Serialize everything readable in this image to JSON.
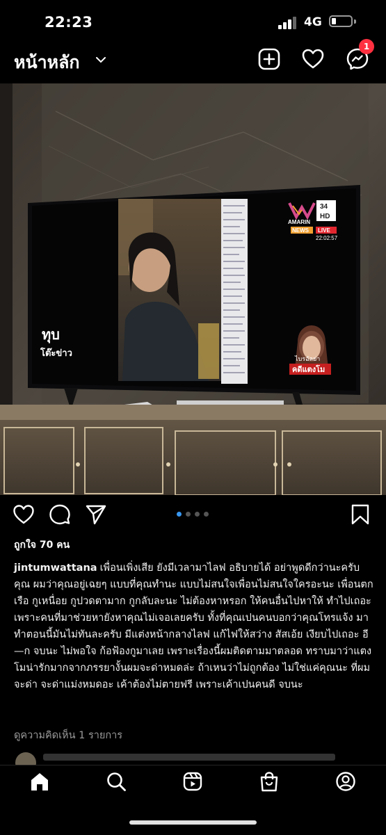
{
  "status": {
    "time": "22:23",
    "network": "4G"
  },
  "header": {
    "title": "หน้าหลัก",
    "notification_count": "1"
  },
  "post": {
    "likes": "ถูกใจ 70 คน",
    "username": "jintumwattana",
    "caption": "เพื่อนเพิ่งเสีย ยังมีเวลามาไลฟ อธิบายได้ อย่าพูดดีกว่านะครับ คุณ ผมว่าคุณอยู่เฉยๆ แบบที่คุณทำนะ แบบไม่สนใจเพื่อนไม่สนใจใครอะนะ เพื่อนตกเรือ กูเหนื่อย กูปวดตามาก กูกลับละนะ ไม่ต้องหาหรอก ให้คนอื่นไปหาให้ ทำไปเถอะ เพราะคนที่มาช่วยหายังหาคุณไม่เจอเลยครับ ทั้งที่คุณเปนคนบอกว่าคุณโทรแจ้ง มาทำตอนนี้มันไม่ทันละครับ มีแต่งหน้ากลางไลฟ แก้ไฟให้สว่าง สัสเอ้ย เงียบไปเถอะ อี—ก จบนะ ไม่พอใจ ก้อฟ้องกูมาเลย เพราะเรื่องนี้ผมติดตามมาตลอด ทราบมาว่าแตง โมน่ารักมากจากภรรยางั้นผมจะด่าหมดล่ะ ถ้าเหนว่าไม่ถูกต้อง ไม่ใช่แค่คุณนะ ที่ผมจะด่า จะด่าแม่งหมดอะ เค้าต้องไม่ตายฟรี เพราะเค้าเปนคนดี จบนะ",
    "comments_link": "ดูความคิดเห็น 1 รายการ",
    "carousel": {
      "count": 4,
      "active": 0
    },
    "photo": {
      "tv_channel_logo": "AMARIN",
      "tv_channel_number": "34",
      "tv_channel_hd": "HD",
      "tv_news_tag": "NEWS",
      "tv_live_tag": "LIVE",
      "tv_clock": "22:02:57",
      "tv_show_logo_line1": "ทุบ",
      "tv_show_logo_line2": "โต๊ะข่าว",
      "tv_lower_badge_line1": "ไบรอัลย่า",
      "tv_lower_badge_line2": "คดีแตงโม"
    }
  },
  "icons": {
    "new_post": "plus-square-icon",
    "activity": "heart-icon",
    "messenger": "messenger-icon",
    "like": "heart-icon",
    "comment": "comment-icon",
    "share": "send-icon",
    "save": "bookmark-icon",
    "tabs": [
      "home-icon",
      "search-icon",
      "reels-icon",
      "shop-icon",
      "profile-icon"
    ]
  },
  "colors": {
    "accent": "#3897f0",
    "badge": "#ff3040",
    "live": "#e2262f"
  }
}
